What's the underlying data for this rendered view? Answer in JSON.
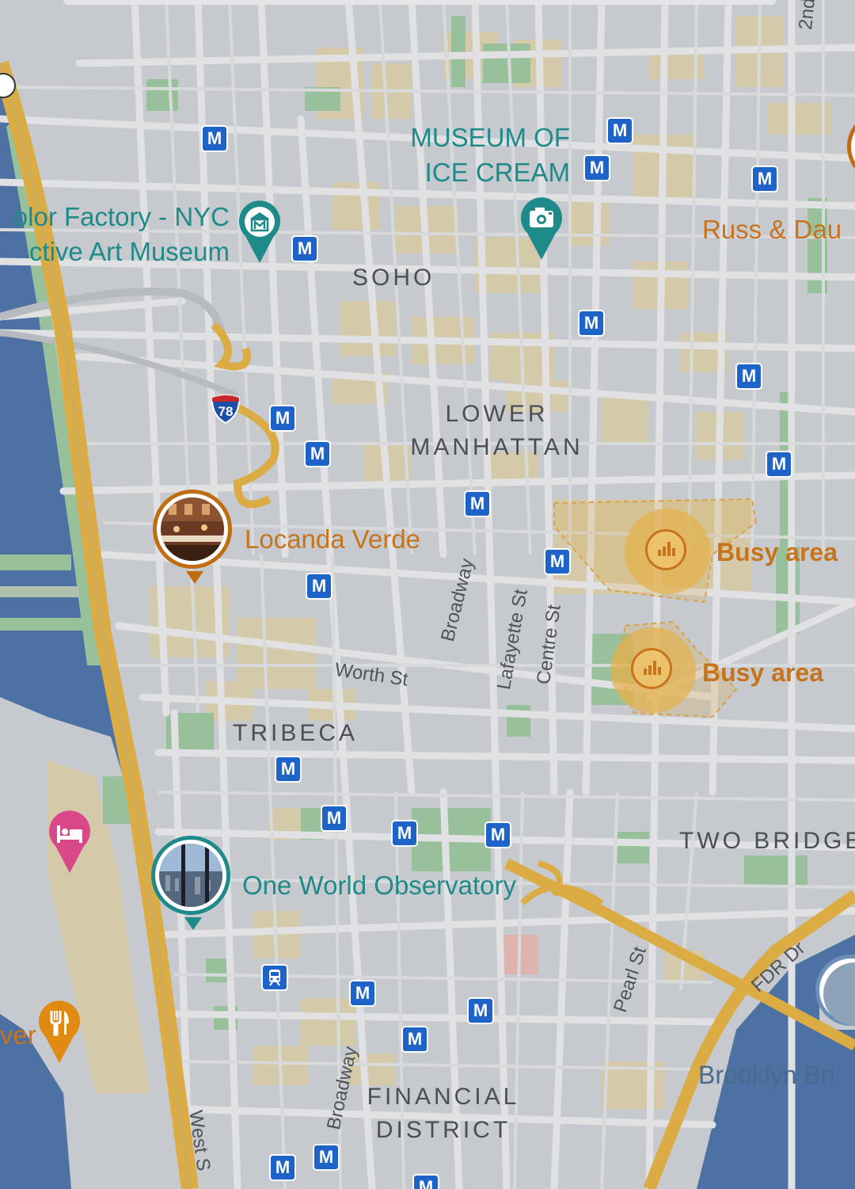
{
  "map": {
    "colors": {
      "land": "#cfd2d6",
      "block_beige": "#ddd3b1",
      "park": "#9ec9a1",
      "water": "#4e74a8",
      "highway": "#e6b345",
      "road": "#ebebed",
      "metro": "#1d63c8",
      "teal_text": "#1f8a8a",
      "orange_text": "#c7741d"
    },
    "districts": {
      "soho": "SOHO",
      "lower_manhattan_line1": "LOWER",
      "lower_manhattan_line2": "MANHATTAN",
      "tribeca": "TRIBECA",
      "financial_line1": "FINANCIAL",
      "financial_line2": "DISTRICT",
      "two_bridges": "TWO BRIDGE"
    },
    "pois": {
      "museum_ice_cream_line1": "MUSEUM OF",
      "museum_ice_cream_line2": "ICE CREAM",
      "color_factory_line1": "olor Factory - NYC",
      "color_factory_line2": "ctive Art Museum",
      "locanda_verde": "Locanda Verde",
      "one_world": "One World Observatory",
      "russ_daughters": "Russ & Dau",
      "left_cut": "ver",
      "brooklyn_bridge": "Brooklyn Bri"
    },
    "streets": {
      "worth_st": "Worth St",
      "broadway_upper": "Broadway",
      "broadway_lower": "Broadway",
      "lafayette_st": "Lafayette St",
      "centre_st": "Centre St",
      "pearl_st": "Pearl St",
      "fdr_dr": "FDR Dr",
      "west_st": "West S",
      "second": "2nd"
    },
    "shields": {
      "i78": "78"
    },
    "busy": {
      "label1": "Busy area",
      "label2": "Busy area"
    },
    "metro_letter": "M",
    "icons": [
      "museum-icon",
      "camera-icon",
      "hotel-icon",
      "restaurant-icon",
      "train-icon",
      "busy-area-icon",
      "metro-icon",
      "interstate-shield-icon"
    ]
  }
}
